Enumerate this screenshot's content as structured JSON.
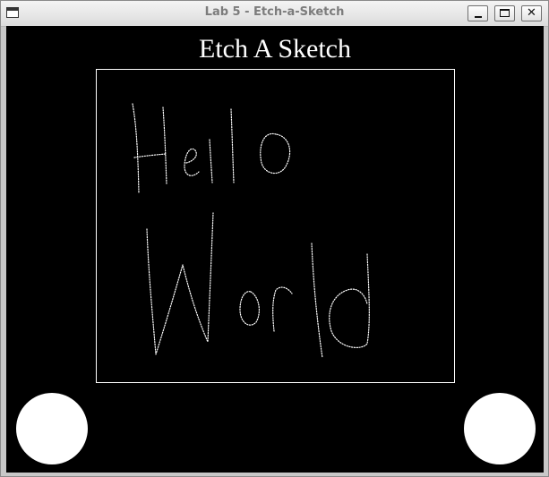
{
  "window": {
    "title": "Lab 5 - Etch-a-Sketch",
    "icon": "app-window-icon",
    "controls": {
      "minimize_icon": "minimize-icon",
      "maximize_icon": "maximize-icon",
      "close_label": "✕"
    }
  },
  "app": {
    "heading": "Etch A Sketch",
    "background_color": "#000000",
    "drawing_color": "#ffffff"
  },
  "knobs": {
    "left": "horizontal-knob",
    "right": "vertical-knob"
  }
}
